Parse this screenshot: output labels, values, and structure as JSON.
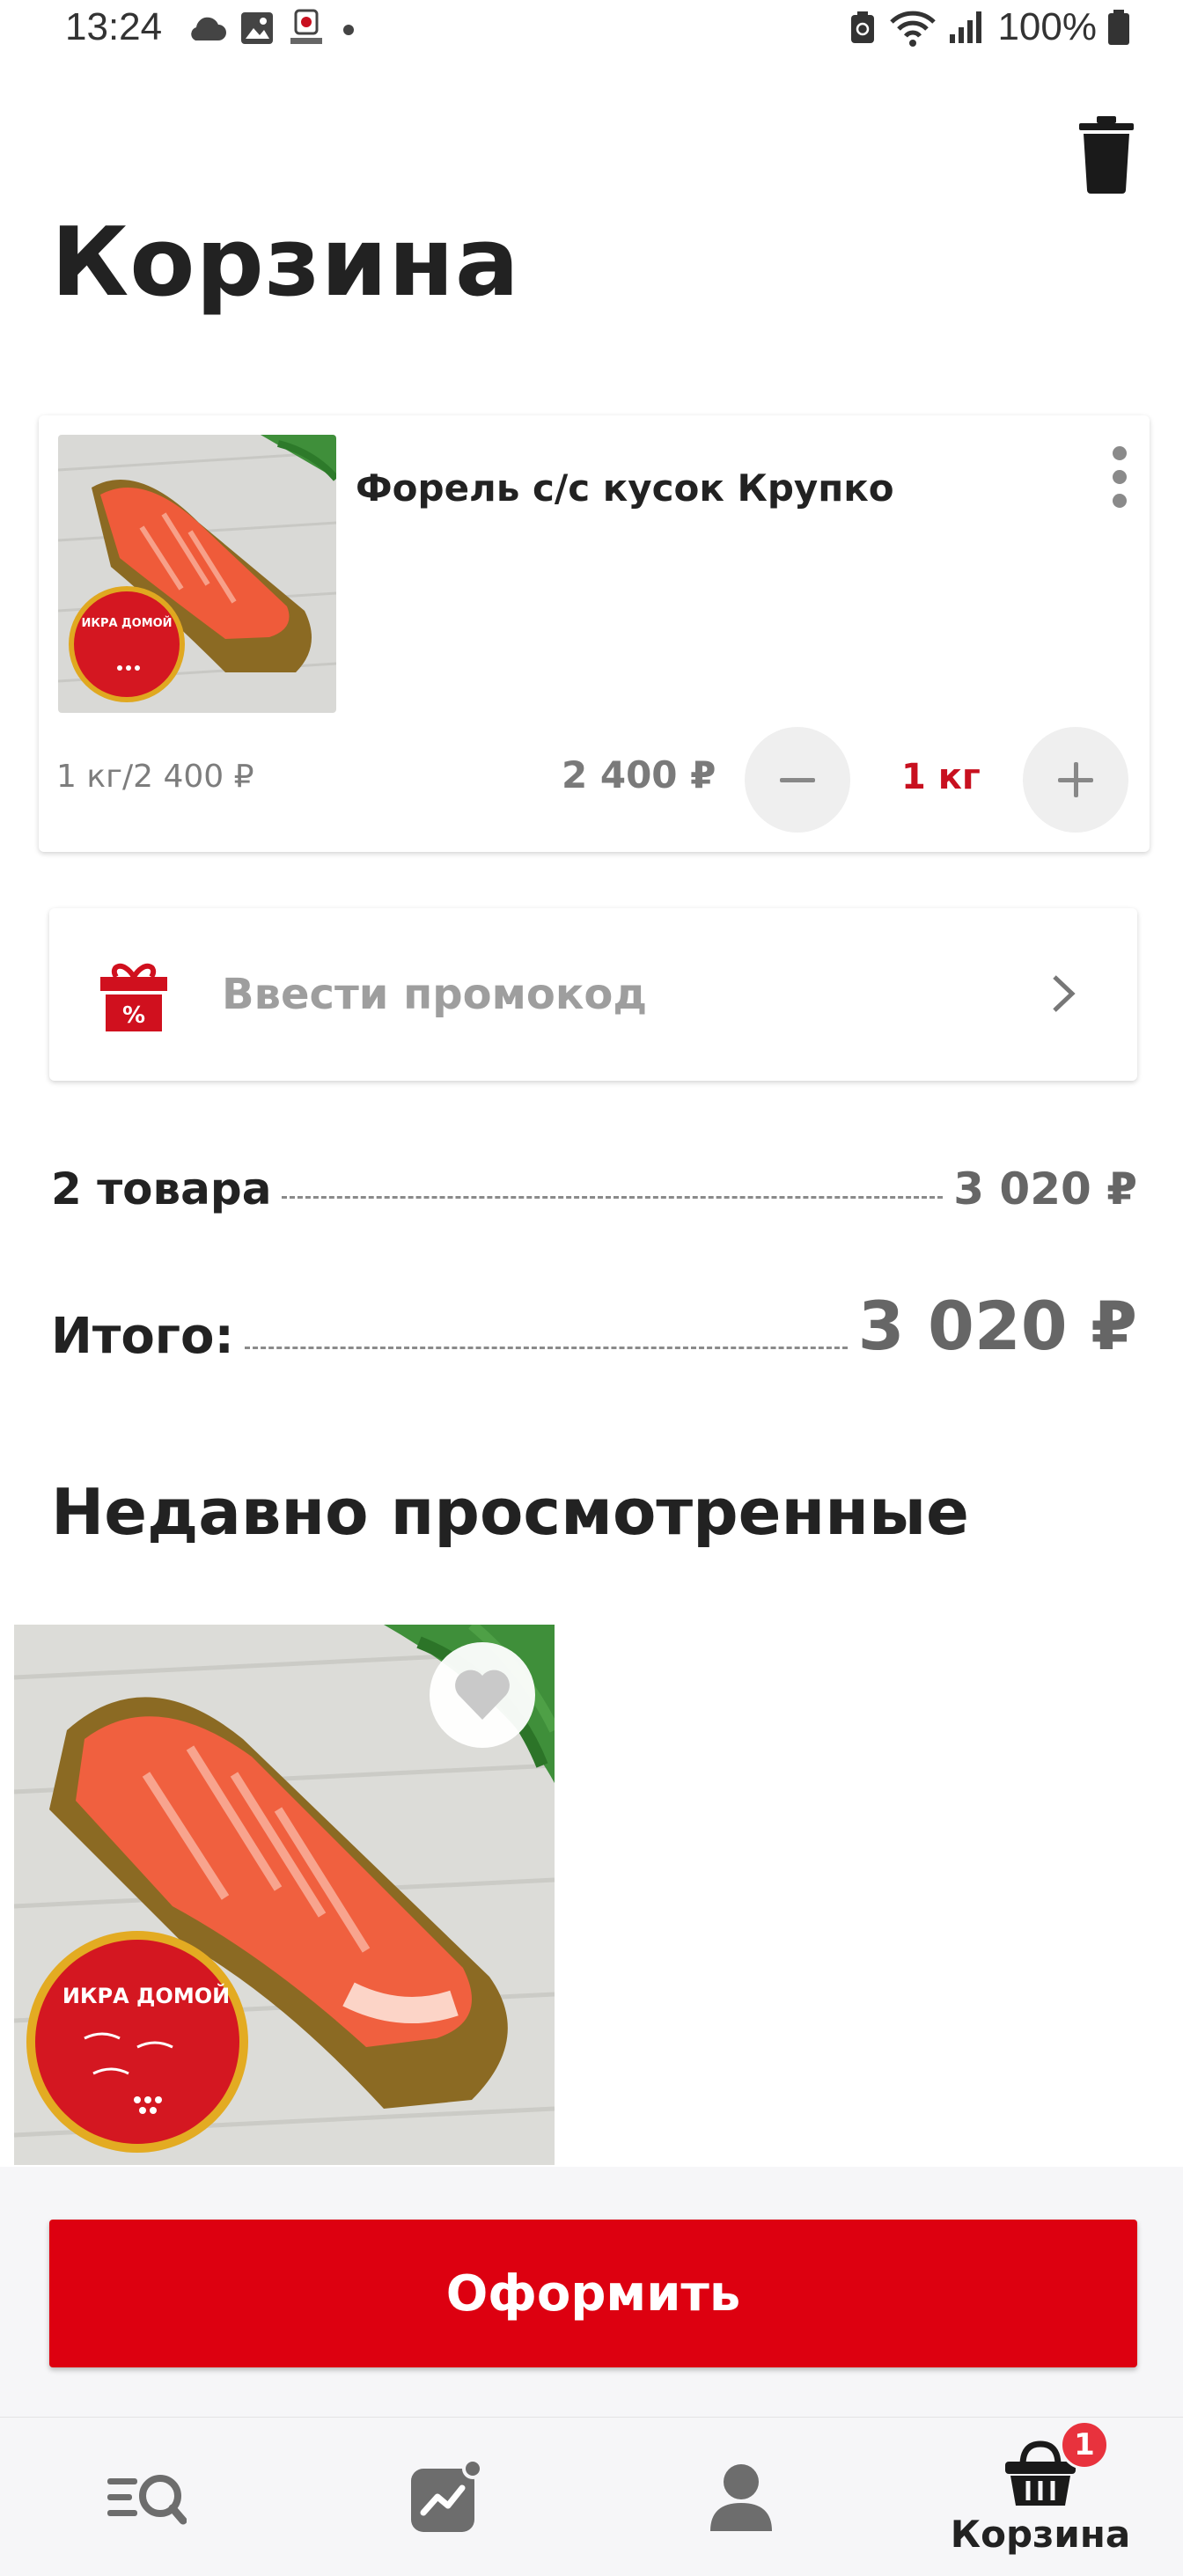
{
  "status_bar": {
    "time": "13:24",
    "battery": "100%"
  },
  "header": {
    "title": "Корзина"
  },
  "cart": {
    "items": [
      {
        "name": "Форель с/с кусок Крупко",
        "unit_price": "1 кг/2 400 ₽",
        "line_price": "2 400 ₽",
        "quantity": "1 кг"
      }
    ]
  },
  "promo": {
    "label": "Ввести промокод"
  },
  "summary": {
    "items_label": "2 товара",
    "items_value": "3 020 ₽",
    "total_label": "Итого:",
    "total_value": "3 020 ₽"
  },
  "recent": {
    "title": "Недавно просмотренные",
    "thumb_badge_text": "ИКРА ДОМОЙ"
  },
  "checkout": {
    "label": "Оформить"
  },
  "bottom_nav": {
    "items": [
      {
        "icon": "catalog-search-icon",
        "label": ""
      },
      {
        "icon": "promo-chart-icon",
        "label": ""
      },
      {
        "icon": "profile-icon",
        "label": ""
      },
      {
        "icon": "basket-icon",
        "label": "Корзина",
        "badge": "1"
      }
    ]
  },
  "colors": {
    "accent": "#dd0010",
    "badge": "#e8323d",
    "text": "#222222",
    "muted": "#9e9e9e"
  }
}
